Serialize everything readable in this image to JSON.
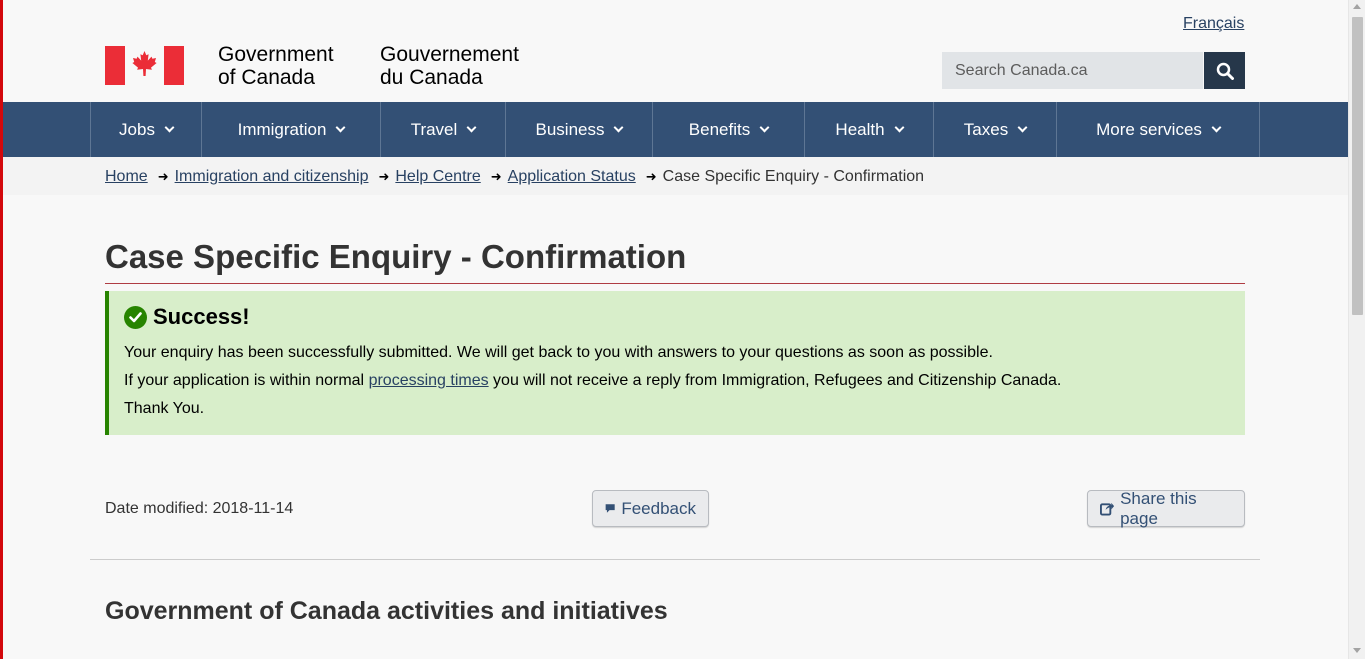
{
  "header": {
    "language_link": "Français",
    "signature_en_line1": "Government",
    "signature_en_line2": "of Canada",
    "signature_fr_line1": "Gouvernement",
    "signature_fr_line2": "du Canada",
    "search_placeholder": "Search Canada.ca",
    "search_icon": "magnifier-icon"
  },
  "nav": {
    "items": [
      {
        "label": "Jobs"
      },
      {
        "label": "Immigration"
      },
      {
        "label": "Travel"
      },
      {
        "label": "Business"
      },
      {
        "label": "Benefits"
      },
      {
        "label": "Health"
      },
      {
        "label": "Taxes"
      },
      {
        "label": "More services"
      }
    ]
  },
  "breadcrumb": {
    "items": [
      {
        "label": "Home"
      },
      {
        "label": "Immigration and citizenship"
      },
      {
        "label": "Help Centre"
      },
      {
        "label": "Application Status"
      }
    ],
    "current": "Case Specific Enquiry - Confirmation"
  },
  "main": {
    "title": "Case Specific Enquiry - Confirmation",
    "alert": {
      "title": "Success!",
      "line1": "Your enquiry has been successfully submitted. We will get back to you with answers to your questions as soon as possible.",
      "line2_before": "If your application is within normal ",
      "line2_link": "processing times",
      "line2_after": " you will not receive a reply from Immigration, Refugees and Citizenship Canada.",
      "line3": "Thank You."
    },
    "date_modified": "Date modified: 2018-11-14",
    "feedback_label": "Feedback",
    "share_label": "Share this page"
  },
  "footer": {
    "heading": "Government of Canada activities and initiatives"
  },
  "colors": {
    "nav_bg": "#335075",
    "flag_red": "#eb2d37",
    "success_bg": "#d8eeca",
    "success_border": "#278400",
    "link": "#284162"
  }
}
